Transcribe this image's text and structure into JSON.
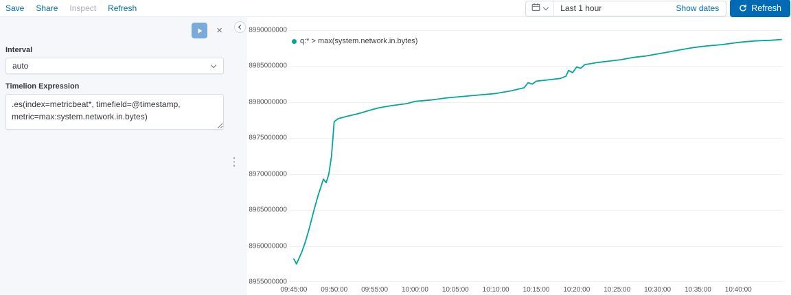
{
  "top_bar": {
    "links": [
      {
        "label": "Save",
        "disabled": false
      },
      {
        "label": "Share",
        "disabled": false
      },
      {
        "label": "Inspect",
        "disabled": true
      },
      {
        "label": "Refresh",
        "disabled": false
      }
    ],
    "time_picker": {
      "value": "Last 1 hour",
      "show_dates_label": "Show dates",
      "refresh_button_label": "Refresh"
    }
  },
  "sidebar": {
    "interval_label": "Interval",
    "interval_value": "auto",
    "expression_label": "Timelion Expression",
    "expression_value": ".es(index=metricbeat*, timefield=@timestamp, metric=max:system.network.in.bytes)"
  },
  "icons": {
    "close_glyph": "×"
  },
  "colors": {
    "accent_blue": "#006BB4",
    "line_teal": "#00a69a",
    "disabled_gray": "#a6aebc"
  },
  "chart_data": {
    "type": "line",
    "legend": "q:* > max(system.network.in.bytes)",
    "line_color": "#00a69a",
    "ylim": [
      8955000000,
      8990000000
    ],
    "y_ticks": [
      "8990000000",
      "8985000000",
      "8980000000",
      "8975000000",
      "8970000000",
      "8965000000",
      "8960000000",
      "8955000000"
    ],
    "x_ticks": [
      "09:45:00",
      "09:50:00",
      "09:55:00",
      "10:00:00",
      "10:05:00",
      "10:10:00",
      "10:15:00",
      "10:20:00",
      "10:25:00",
      "10:30:00",
      "10:35:00",
      "10:40:00"
    ],
    "x_domain": [
      "09:44:30",
      "10:45:30"
    ],
    "grid": "horizontal",
    "legend_position": "top-left",
    "points": [
      [
        "09:45:00",
        8958200000
      ],
      [
        "09:45:20",
        8957500000
      ],
      [
        "09:46:00",
        8959200000
      ],
      [
        "09:46:30",
        8960800000
      ],
      [
        "09:47:00",
        8962800000
      ],
      [
        "09:47:30",
        8965000000
      ],
      [
        "09:48:00",
        8967000000
      ],
      [
        "09:48:40",
        8969300000
      ],
      [
        "09:49:00",
        8968800000
      ],
      [
        "09:49:20",
        8970000000
      ],
      [
        "09:49:40",
        8972500000
      ],
      [
        "09:50:00",
        8977300000
      ],
      [
        "09:50:30",
        8977700000
      ],
      [
        "09:51:30",
        8978000000
      ],
      [
        "09:53:00",
        8978400000
      ],
      [
        "09:54:30",
        8978900000
      ],
      [
        "09:55:30",
        8979200000
      ],
      [
        "09:57:00",
        8979500000
      ],
      [
        "09:59:00",
        8979800000
      ],
      [
        "10:00:00",
        8980100000
      ],
      [
        "10:02:00",
        8980300000
      ],
      [
        "10:04:00",
        8980600000
      ],
      [
        "10:06:00",
        8980800000
      ],
      [
        "10:08:00",
        8981000000
      ],
      [
        "10:10:00",
        8981200000
      ],
      [
        "10:12:00",
        8981600000
      ],
      [
        "10:13:30",
        8982000000
      ],
      [
        "10:14:00",
        8982700000
      ],
      [
        "10:14:30",
        8982500000
      ],
      [
        "10:15:00",
        8982900000
      ],
      [
        "10:16:30",
        8983100000
      ],
      [
        "10:18:00",
        8983300000
      ],
      [
        "10:18:40",
        8983600000
      ],
      [
        "10:19:00",
        8984400000
      ],
      [
        "10:19:30",
        8984100000
      ],
      [
        "10:20:00",
        8984900000
      ],
      [
        "10:20:30",
        8984700000
      ],
      [
        "10:21:00",
        8985200000
      ],
      [
        "10:22:30",
        8985500000
      ],
      [
        "10:24:00",
        8985700000
      ],
      [
        "10:25:30",
        8985900000
      ],
      [
        "10:27:00",
        8986200000
      ],
      [
        "10:28:30",
        8986400000
      ],
      [
        "10:30:00",
        8986700000
      ],
      [
        "10:31:30",
        8987000000
      ],
      [
        "10:33:00",
        8987300000
      ],
      [
        "10:34:30",
        8987600000
      ],
      [
        "10:36:00",
        8987800000
      ],
      [
        "10:38:00",
        8988000000
      ],
      [
        "10:40:00",
        8988300000
      ],
      [
        "10:42:00",
        8988500000
      ],
      [
        "10:44:00",
        8988600000
      ],
      [
        "10:45:20",
        8988700000
      ]
    ]
  }
}
